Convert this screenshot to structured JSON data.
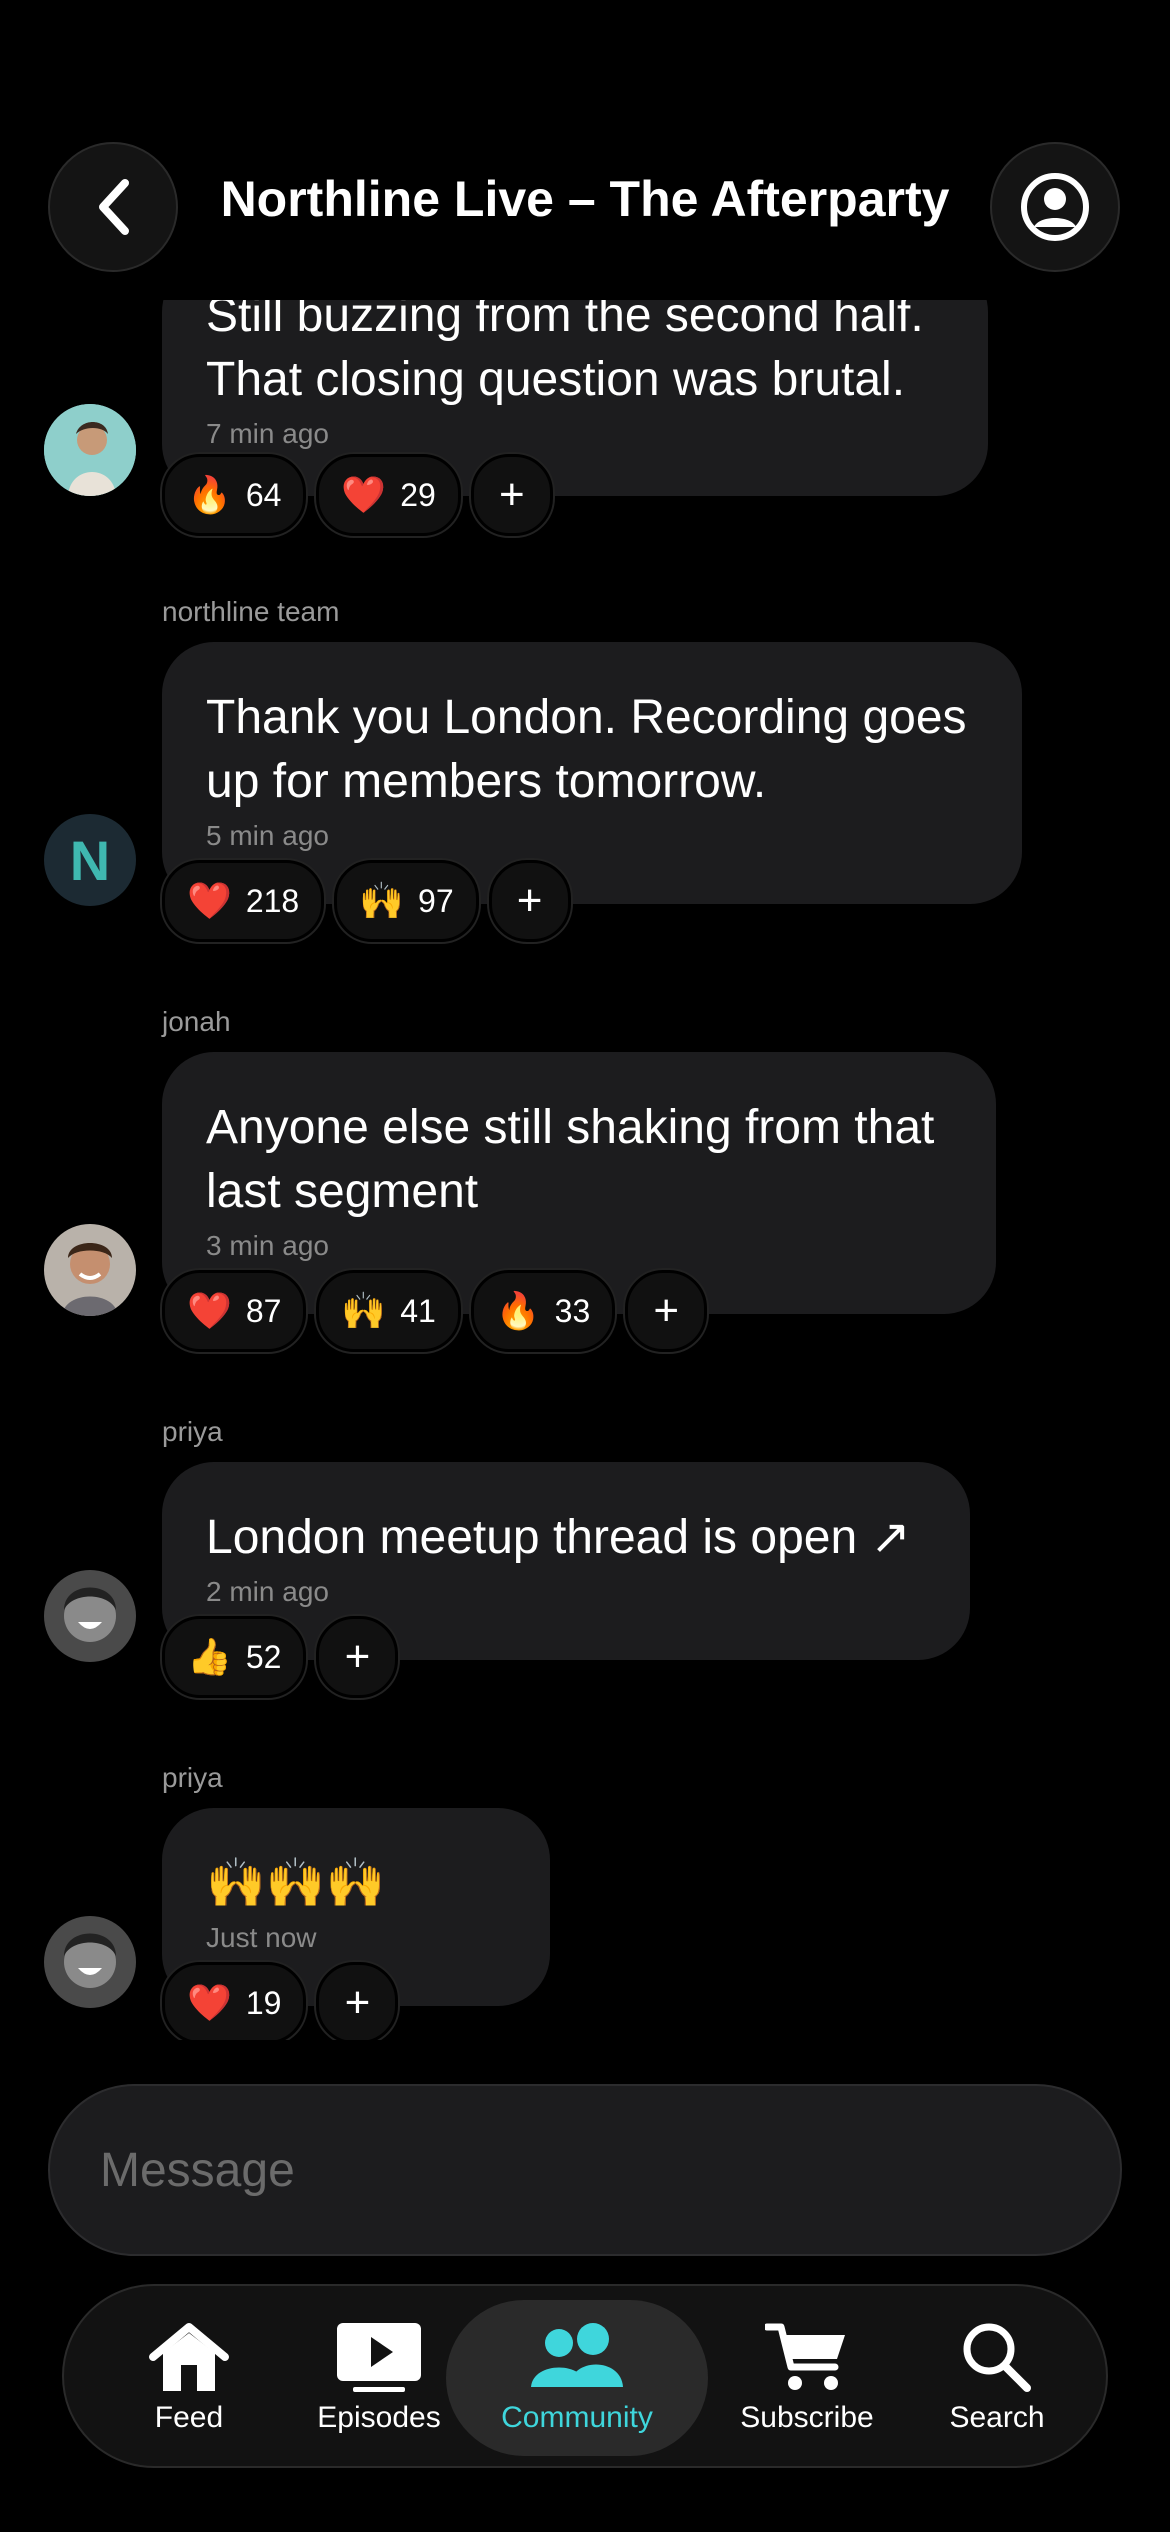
{
  "header": {
    "title": "Northline Live – The Afterparty",
    "back_icon": "chevron-left-icon",
    "profile_icon": "account-circle-icon"
  },
  "messages": [
    {
      "author": "",
      "text_line1": "Still buzzing from the second half.",
      "text_line2": "That closing question was brutal.",
      "time": "7 min ago",
      "reactions": [
        {
          "emoji": "🔥",
          "count": "64"
        },
        {
          "emoji": "❤️",
          "count": "29"
        }
      ]
    },
    {
      "author": "northline team",
      "avatar_letter": "N",
      "text_line1": "Thank you London. Recording goes",
      "text_line2": "up for members tomorrow.",
      "time": "5 min ago",
      "reactions": [
        {
          "emoji": "❤️",
          "count": "218"
        },
        {
          "emoji": "🙌",
          "count": "97"
        }
      ]
    },
    {
      "author": "jonah",
      "text_line1": "Anyone else still shaking from that",
      "text_line2": "last segment",
      "time": "3 min ago",
      "reactions": [
        {
          "emoji": "❤️",
          "count": "87"
        },
        {
          "emoji": "🙌",
          "count": "41"
        },
        {
          "emoji": "🔥",
          "count": "33"
        }
      ]
    },
    {
      "author": "priya",
      "text_line1": "London meetup thread is open ↗",
      "time": "2 min ago",
      "reactions": [
        {
          "emoji": "👍",
          "count": "52"
        }
      ]
    },
    {
      "author": "priya",
      "text_line1": "🙌🙌🙌",
      "time": "Just now",
      "reactions": [
        {
          "emoji": "❤️",
          "count": "19"
        }
      ]
    }
  ],
  "add_reaction_label": "+",
  "composer": {
    "placeholder": "Message"
  },
  "tabs": [
    {
      "label": "Feed",
      "icon": "home-icon"
    },
    {
      "label": "Episodes",
      "icon": "play-icon"
    },
    {
      "label": "Community",
      "icon": "people-icon",
      "active": true
    },
    {
      "label": "Subscribe",
      "icon": "cart-icon"
    },
    {
      "label": "Search",
      "icon": "search-icon"
    }
  ],
  "colors": {
    "accent": "#3fd6dc",
    "bubble": "#1c1c1e",
    "background": "#000000"
  }
}
